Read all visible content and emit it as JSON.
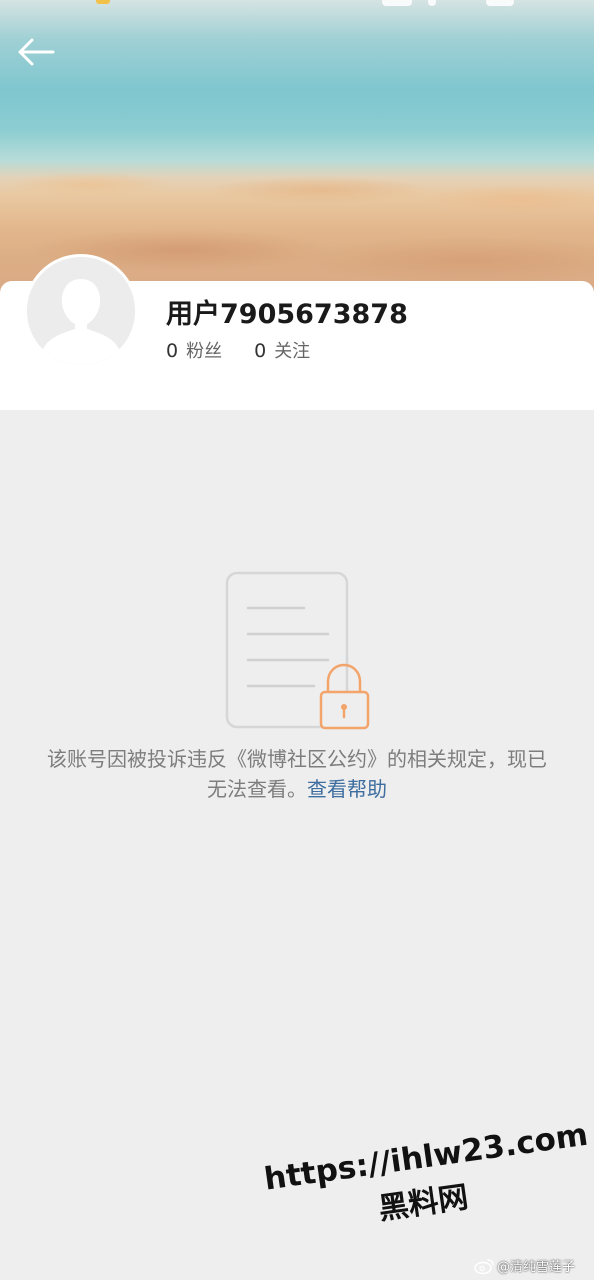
{
  "profile": {
    "username": "用户7905673878",
    "followers_count": "0",
    "followers_label": "粉丝",
    "following_count": "0",
    "following_label": "关注"
  },
  "notice": {
    "message": "该账号因被投诉违反《微博社区公约》的相关规定，现已无法查看。",
    "help_link": "查看帮助"
  },
  "watermark": {
    "site_url": "https://ihlw23.com",
    "site_name": "黑料网",
    "weibo_handle": "@清纯雪莲子"
  },
  "icons": {
    "back": "back-arrow-icon",
    "avatar": "default-avatar-icon",
    "document": "document-icon",
    "lock": "lock-icon",
    "weibo": "weibo-logo-icon"
  },
  "colors": {
    "page_bg": "#eeeeee",
    "card_bg": "#ffffff",
    "link": "#3e6e9f",
    "lock_orange": "#f3a46a",
    "muted_text": "#7d7d7d"
  }
}
